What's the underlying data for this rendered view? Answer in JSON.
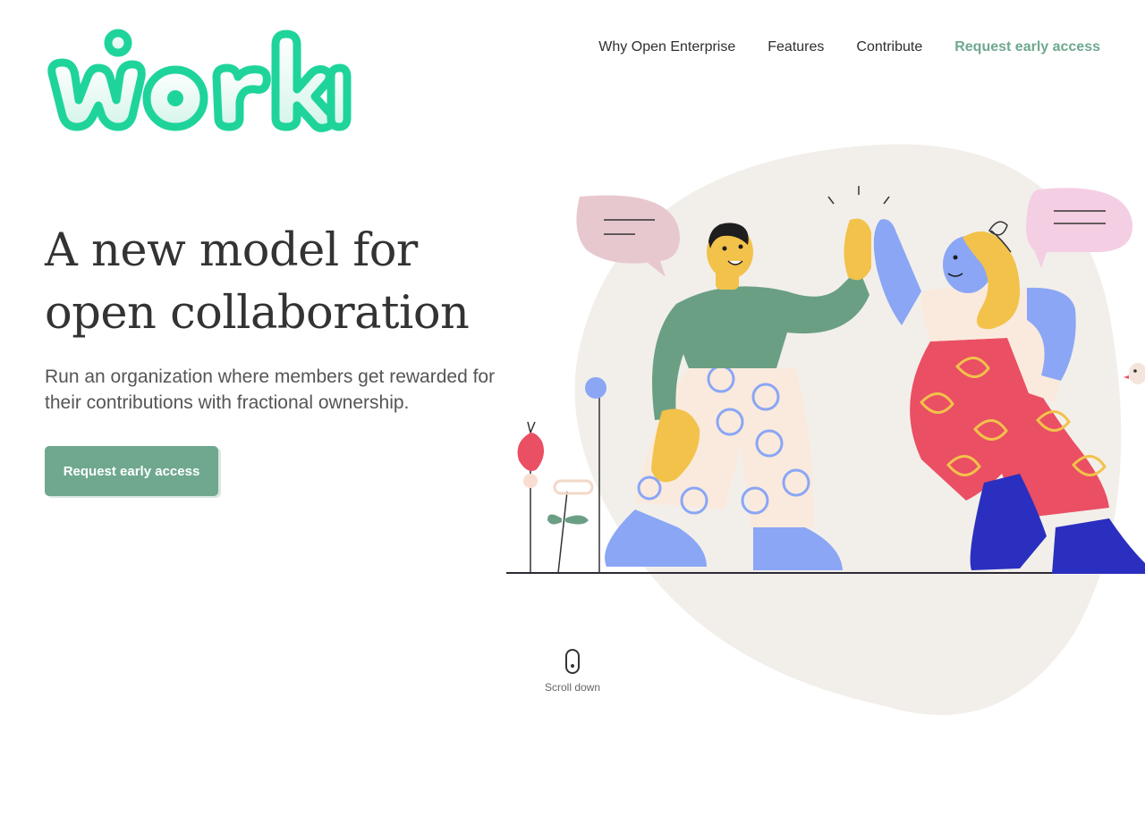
{
  "brand": {
    "name": "worki",
    "color": "#1fd49b"
  },
  "nav": {
    "items": [
      {
        "label": "Why Open Enterprise"
      },
      {
        "label": "Features"
      },
      {
        "label": "Contribute"
      }
    ],
    "cta_label": "Request early access"
  },
  "hero": {
    "title_line1": "A new model for",
    "title_line2": "open collaboration",
    "subtitle": "Run an organization where members get rewarded for their contributions with fractional ownership.",
    "cta_label": "Request early access"
  },
  "scroll": {
    "label": "Scroll down"
  },
  "colors": {
    "accent": "#6fa88f",
    "blob": "#f2efea",
    "green_shirt": "#6b9f84",
    "yellow_skin": "#f2c24b",
    "blue": "#8aa6f5",
    "red_pants": "#ea4f63",
    "navy_boots": "#2b2fbf",
    "pink_bubble": "#e8c8cf"
  }
}
